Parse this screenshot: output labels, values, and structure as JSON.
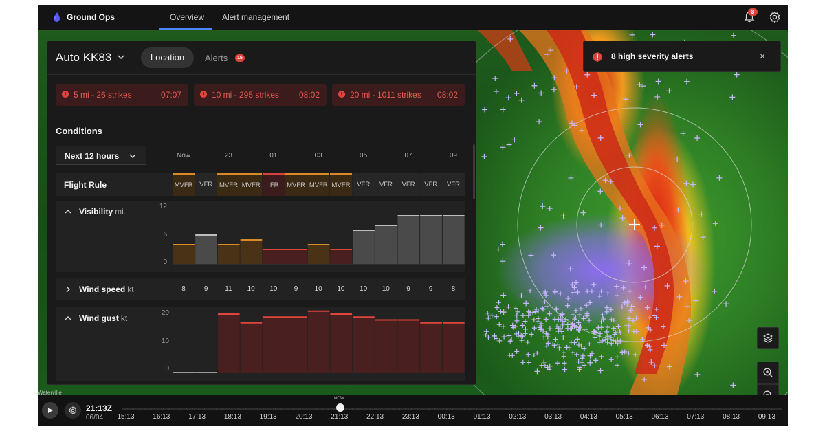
{
  "app": {
    "brand": "Ground Ops",
    "nav_tabs": [
      {
        "label": "Overview",
        "active": true
      },
      {
        "label": "Alert management",
        "active": false
      }
    ],
    "notifications_count": "8"
  },
  "toast": {
    "text": "8 high severity alerts",
    "close": "×"
  },
  "map": {
    "place_label": "Waterville"
  },
  "panel": {
    "location_title": "Auto KK83",
    "tabs": [
      {
        "label": "Location",
        "active": true
      },
      {
        "label": "Alerts",
        "badge": "15"
      }
    ],
    "strikes": [
      {
        "text": "5 mi - 26 strikes",
        "time": "07:07"
      },
      {
        "text": "10 mi - 295 strikes",
        "time": "08:02"
      },
      {
        "text": "20 mi - 1011 strikes",
        "time": "08:02"
      }
    ],
    "conditions_heading": "Conditions",
    "time_range": "Next 12 hours",
    "hour_labels": [
      {
        "label": "Now",
        "col": 0
      },
      {
        "label": "23",
        "col": 2
      },
      {
        "label": "01",
        "col": 4
      },
      {
        "label": "03",
        "col": 6
      },
      {
        "label": "05",
        "col": 8
      },
      {
        "label": "07",
        "col": 10
      },
      {
        "label": "09",
        "col": 12
      }
    ],
    "flight_rule": {
      "label": "Flight Rule",
      "values": [
        "MVFR",
        "VFR",
        "MVFR",
        "MVFR",
        "IFR",
        "MVFR",
        "MVFR",
        "MVFR",
        "VFR",
        "VFR",
        "VFR",
        "VFR",
        "VFR"
      ]
    },
    "visibility": {
      "label": "Visibility",
      "unit": "mi.",
      "ticks": [
        "12",
        "6",
        "0"
      ],
      "ymax": 12,
      "values": [
        4,
        6,
        4,
        5,
        3,
        3,
        4,
        3,
        7,
        8,
        10,
        10,
        10
      ],
      "rules": [
        "MVFR",
        "VFR",
        "MVFR",
        "MVFR",
        "IFR",
        "IFR",
        "MVFR",
        "IFR",
        "VFR",
        "VFR",
        "VFR",
        "VFR",
        "VFR"
      ]
    },
    "wind_speed": {
      "label": "Wind speed",
      "unit": "kt",
      "values": [
        "8",
        "9",
        "11",
        "10",
        "10",
        "9",
        "10",
        "10",
        "10",
        "10",
        "9",
        "9",
        "8"
      ]
    },
    "wind_gust": {
      "label": "Wind gust",
      "unit": "kt",
      "ticks": [
        "20",
        "10",
        "0"
      ],
      "ymax": 20,
      "values": [
        0,
        0,
        20,
        17,
        19,
        19,
        21,
        20,
        19,
        18,
        18,
        17,
        17
      ]
    }
  },
  "timeline": {
    "current_time": "21:13Z",
    "current_date": "06/04",
    "now_label": "NOW",
    "labels": [
      "15:13",
      "16:13",
      "17:13",
      "18:13",
      "19:13",
      "20:13",
      "21:13",
      "22:13",
      "23:13",
      "00:13",
      "01:13",
      "02:13",
      "03:13",
      "04:13",
      "05:13",
      "06:13",
      "07:13",
      "08:13",
      "09:13"
    ]
  },
  "colors": {
    "accent": "#4f86ff",
    "alert_red": "#e0453d",
    "mvfr_orange": "#d68a28",
    "ifr_red": "#d8443a",
    "vfr_gray": "#bdbdbd",
    "strike_purple": "#b9a6ff"
  },
  "icons": [
    "logo-drop-icon",
    "bell-icon",
    "gear-icon",
    "alert-circle-icon",
    "close-icon",
    "chevron-down-icon",
    "chevron-up-icon",
    "chevron-right-icon",
    "layers-icon",
    "zoom-in-icon",
    "zoom-out-icon",
    "play-icon"
  ]
}
